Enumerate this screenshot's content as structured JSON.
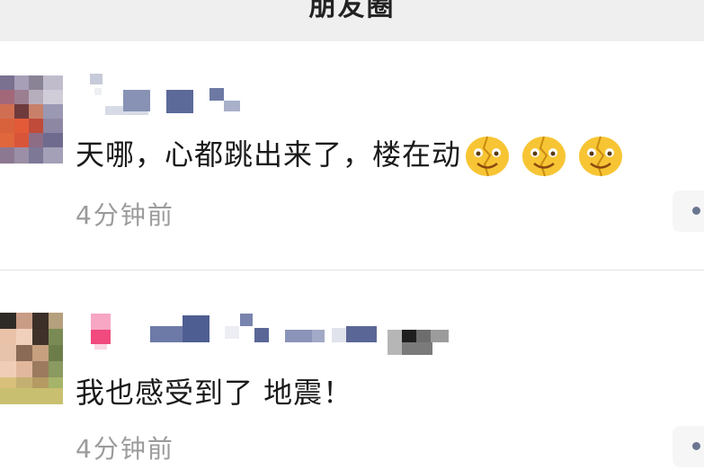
{
  "header": {
    "title": "朋友圈"
  },
  "comments": [
    {
      "text": "天哪，心都跳出来了，楼在动",
      "emojis": [
        "cracked-face-emoji",
        "cracked-face-emoji",
        "cracked-face-emoji"
      ],
      "time": "4分钟前"
    },
    {
      "text": "我也感受到了 地震！",
      "time": "4分钟前"
    }
  ],
  "colors": {
    "time": "#9b9b9b",
    "text": "#1a1a1a",
    "more_dot": "#6b7690",
    "emoji": "#f7c534"
  }
}
